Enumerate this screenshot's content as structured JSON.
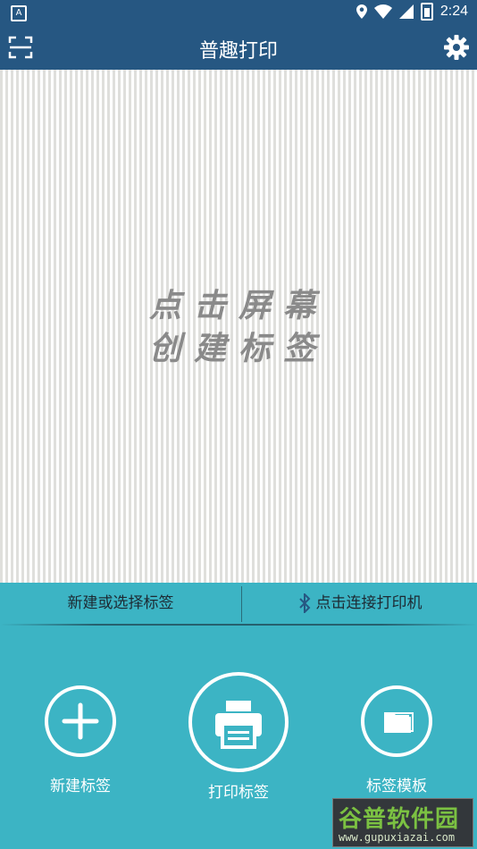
{
  "status_bar": {
    "time": "2:24",
    "left_icon": "A"
  },
  "app_bar": {
    "title": "普趣打印"
  },
  "canvas": {
    "line1": "点击屏幕",
    "line2": "创建标签"
  },
  "sub_bar": {
    "new_or_select": "新建或选择标签",
    "connect_printer": "点击连接打印机"
  },
  "actions": [
    {
      "label": "新建标签"
    },
    {
      "label": "打印标签"
    },
    {
      "label": "标签模板"
    }
  ],
  "watermark": {
    "main": "谷普软件园",
    "url": "www.gupuxiazai.com"
  },
  "colors": {
    "primary": "#265782",
    "panel": "#3cb4c4",
    "text_dark": "#1d2a33"
  }
}
